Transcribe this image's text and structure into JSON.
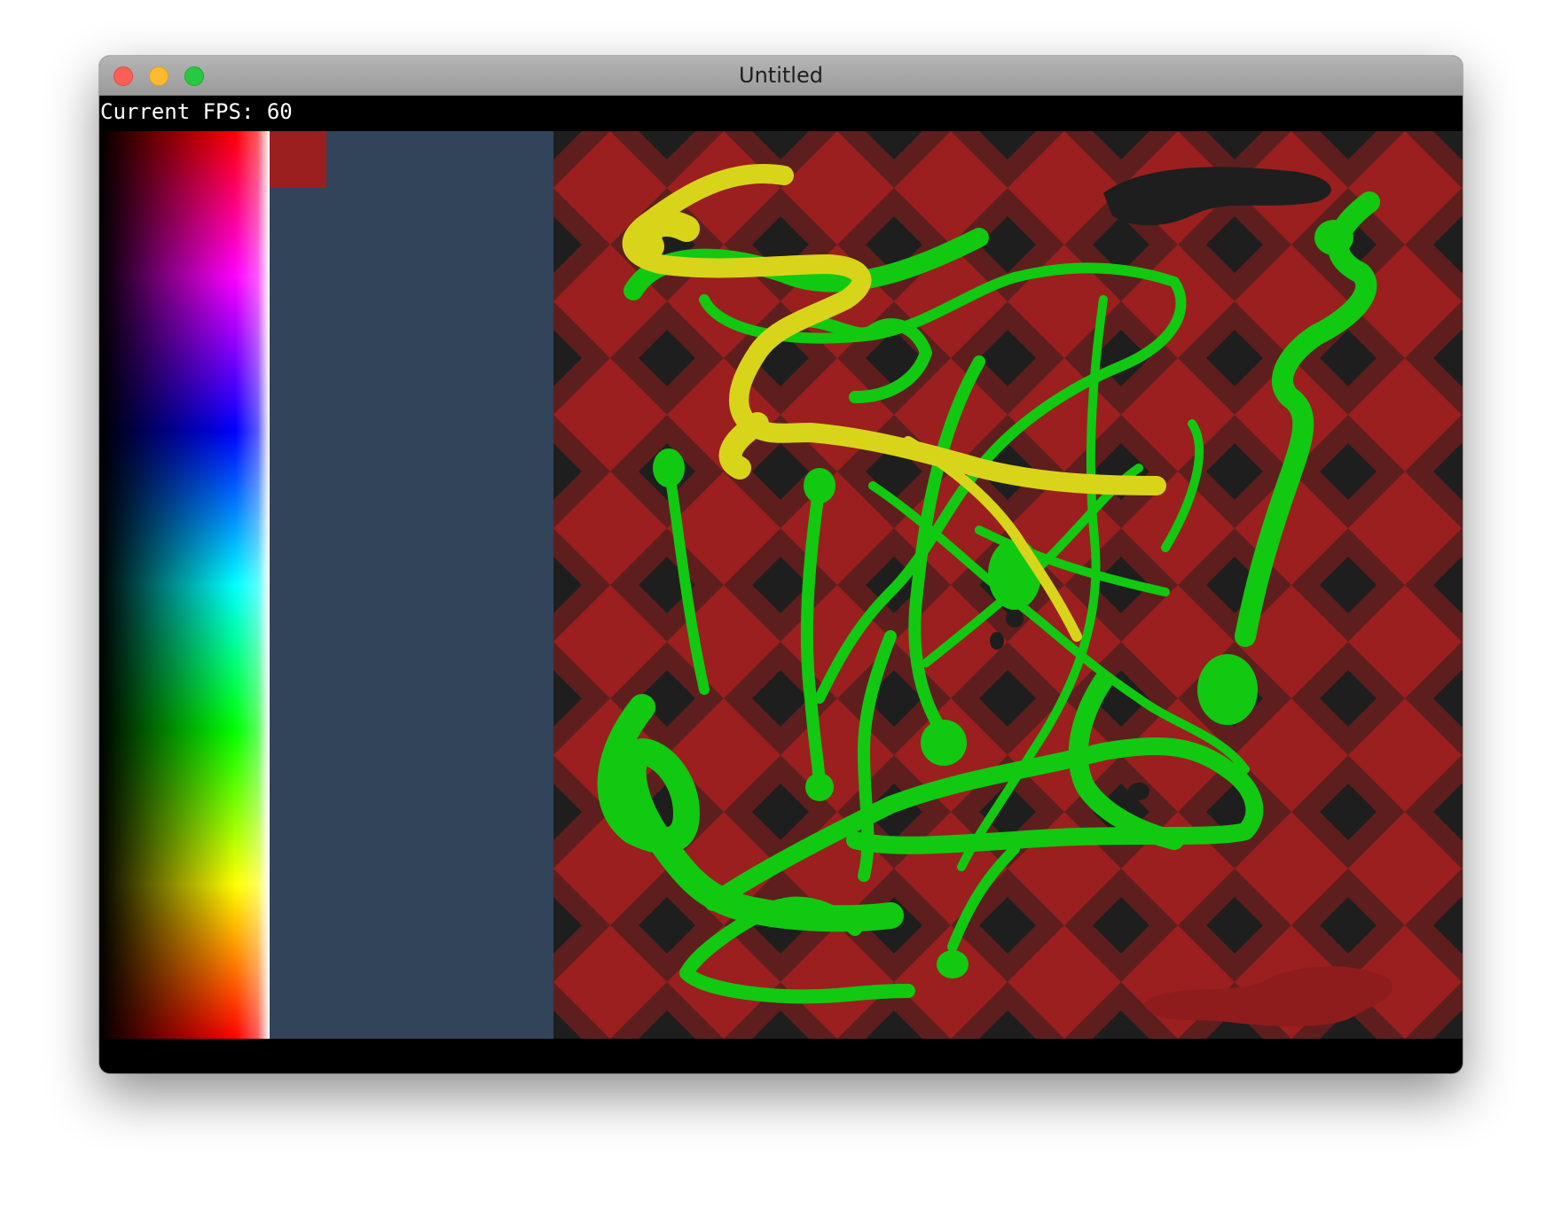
{
  "window": {
    "title": "Untitled"
  },
  "status": {
    "fps_text": "Current FPS: 60"
  },
  "colors": {
    "selected": "#9b1f1f",
    "panel": "#32445a",
    "check_light": "#9b1f1f",
    "check_dark": "#1e1e1e",
    "check_mid": "#5e1e1e",
    "paint_green": "#11c911",
    "paint_yellow": "#d8d41a",
    "paint_red": "#9b1f1f",
    "paint_dark": "#1e1e1e"
  }
}
